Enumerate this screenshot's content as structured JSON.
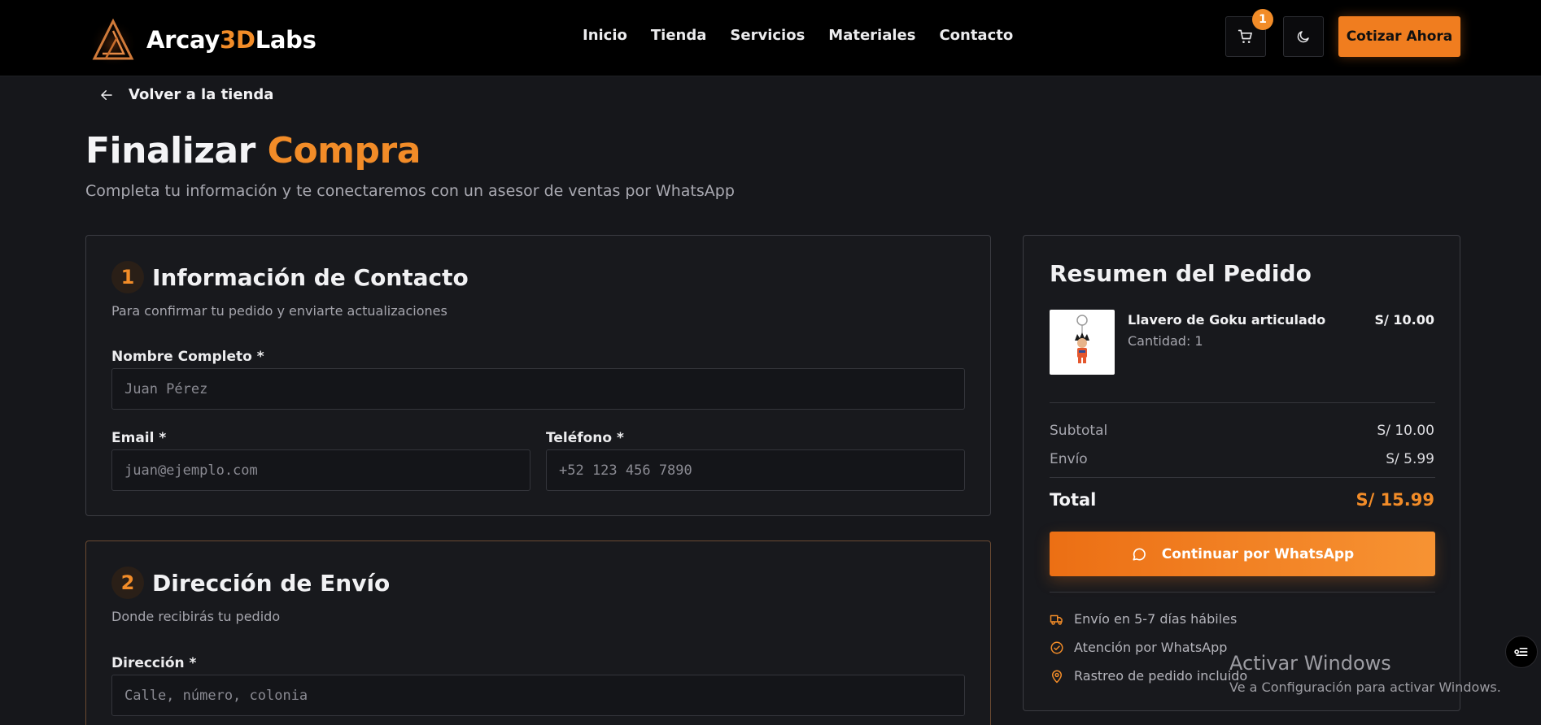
{
  "brand": {
    "name_prefix": "Arcay",
    "name_accent": "3D",
    "name_suffix": "Labs"
  },
  "nav": {
    "links": [
      "Inicio",
      "Tienda",
      "Servicios",
      "Materiales",
      "Contacto"
    ],
    "cart_count": "1",
    "cta_label": "Cotizar Ahora"
  },
  "back": {
    "label": "Volver a la tienda"
  },
  "heading": {
    "title_main": "Finalizar",
    "title_accent": "Compra",
    "subtitle": "Completa tu información y te conectaremos con un asesor de ventas por WhatsApp"
  },
  "contact": {
    "step": "1",
    "title": "Información de Contacto",
    "subtitle": "Para confirmar tu pedido y enviarte actualizaciones",
    "name_label": "Nombre Completo *",
    "name_placeholder": "Juan Pérez",
    "email_label": "Email *",
    "email_placeholder": "juan@ejemplo.com",
    "phone_label": "Teléfono *",
    "phone_placeholder": "+52 123 456 7890"
  },
  "shipping": {
    "step": "2",
    "title": "Dirección de Envío",
    "subtitle": "Donde recibirás tu pedido",
    "address_label": "Dirección *",
    "address_placeholder": "Calle, número, colonia"
  },
  "summary": {
    "title": "Resumen del Pedido",
    "item": {
      "name": "Llavero de Goku articulado",
      "qty": "Cantidad: 1",
      "price": "S/ 10.00"
    },
    "subtotal_label": "Subtotal",
    "subtotal_value": "S/ 10.00",
    "shipping_label": "Envío",
    "shipping_value": "S/ 5.99",
    "total_label": "Total",
    "total_value": "S/ 15.99",
    "whatsapp_label": "Continuar por WhatsApp",
    "features": [
      "Envío en 5-7 días hábiles",
      "Atención por WhatsApp",
      "Rastreo de pedido incluido"
    ]
  },
  "windows": {
    "title": "Activar Windows",
    "subtitle": "Ve a Configuración para activar Windows."
  },
  "colors": {
    "accent": "#f28c28",
    "background": "#16171b",
    "navbar": "#000000"
  },
  "icons": [
    "arrow-left-icon",
    "cart-icon",
    "moon-icon",
    "chat-bubble-icon",
    "truck-icon",
    "check-circle-icon",
    "map-pin-icon",
    "list-icon"
  ]
}
